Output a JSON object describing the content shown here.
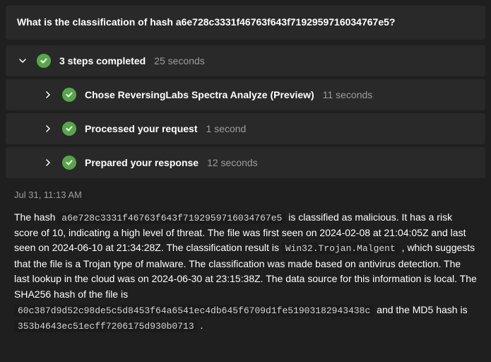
{
  "question": "What is the classification of hash a6e728c3331f46763f643f7192959716034767e5?",
  "summary": {
    "label": "3 steps completed",
    "duration": "25 seconds"
  },
  "steps": [
    {
      "label": "Chose ReversingLabs Spectra Analyze (Preview)",
      "duration": "11 seconds"
    },
    {
      "label": "Processed your request",
      "duration": "1 second"
    },
    {
      "label": "Prepared your response",
      "duration": "12 seconds"
    }
  ],
  "timestamp": "Jul 31, 11:13 AM",
  "response": {
    "t1": "The hash ",
    "hash_sha1": "a6e728c3331f46763f643f7192959716034767e5",
    "t2": " is classified as malicious. It has a risk score of 10, indicating a high level of threat. The file was first seen on 2024-02-08 at 21:04:05Z and last seen on 2024-06-10 at 21:34:28Z. The classification result is ",
    "classification": "Win32.Trojan.Malgent",
    "t3": " , which suggests that the file is a Trojan type of malware. The classification was made based on antivirus detection. The last lookup in the cloud was on 2024-06-30 at 23:15:38Z. The data source for this information is local. The SHA256 hash of the file is ",
    "hash_sha256": "60c387d9d52c98de5c5d8453f64a6541ec4db645f6709d1fe51903182943438c",
    "t4": " and the MD5 hash is ",
    "hash_md5": "353b4643ec51ecff7206175d930b0713",
    "t5": " ."
  }
}
